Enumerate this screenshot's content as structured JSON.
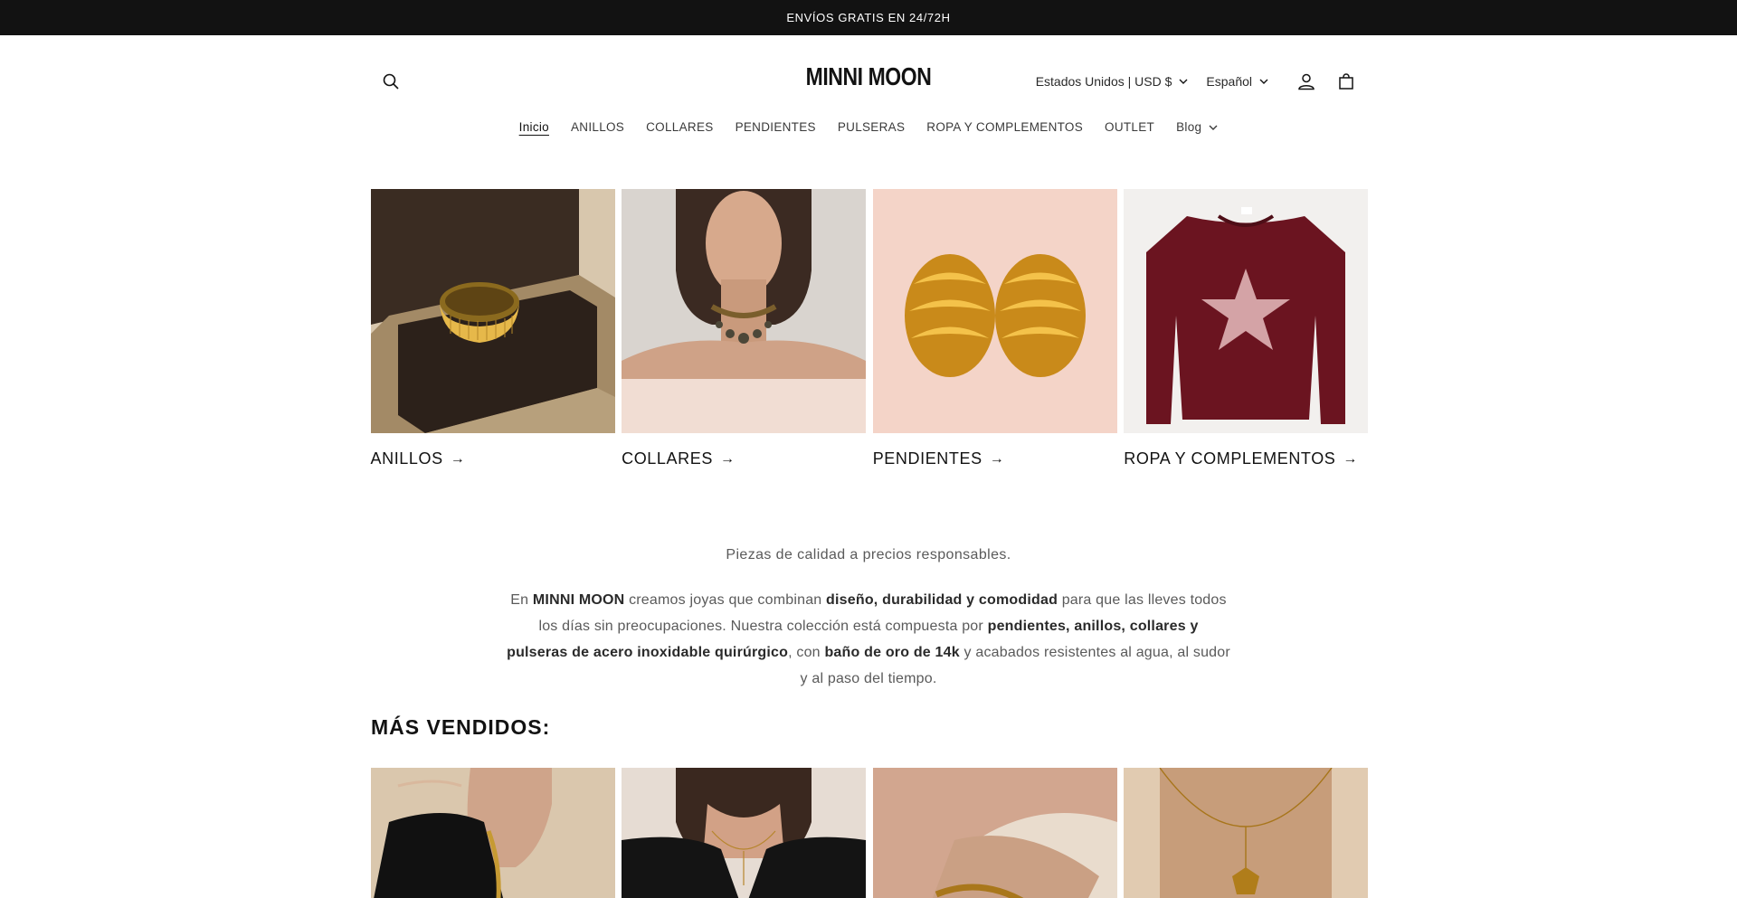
{
  "announcement": {
    "text": "ENVÍOS GRATIS EN 24/72H"
  },
  "header": {
    "logo": "MINNI MOON",
    "country_selector": "Estados Unidos | USD $",
    "language_selector": "Español",
    "icons": {
      "search": "search-icon",
      "account": "account-icon",
      "cart": "cart-icon"
    }
  },
  "nav": {
    "items": [
      {
        "label": "Inicio"
      },
      {
        "label": "ANILLOS"
      },
      {
        "label": "COLLARES"
      },
      {
        "label": "PENDIENTES"
      },
      {
        "label": "PULSERAS"
      },
      {
        "label": "ROPA Y COMPLEMENTOS"
      },
      {
        "label": "OUTLET"
      },
      {
        "label": "Blog"
      }
    ]
  },
  "collections": [
    {
      "title": "ANILLOS"
    },
    {
      "title": "COLLARES"
    },
    {
      "title": "PENDIENTES"
    },
    {
      "title": "ROPA Y COMPLEMENTOS"
    }
  ],
  "intro": {
    "tagline": "Piezas de calidad a precios responsables.",
    "p1": "En ",
    "b1": "MINNI MOON",
    "p2": " creamos joyas que combinan ",
    "b2": "diseño, durabilidad y comodidad",
    "p3": " para que las lleves todos los días sin preocupaciones. Nuestra colección está compuesta por ",
    "b3": "pendientes, anillos, collares y pulseras de acero inoxidable quirúrgico",
    "p4": ", con ",
    "b4": "baño de oro de 14k",
    "p5": " y acabados resistentes al agua, al sudor y al paso del tiempo."
  },
  "bestsellers": {
    "title": "MÁS VENDIDOS:"
  },
  "colors": {
    "announcement_bg": "#121212",
    "text": "#121212",
    "muted": "#5a5a5a"
  }
}
